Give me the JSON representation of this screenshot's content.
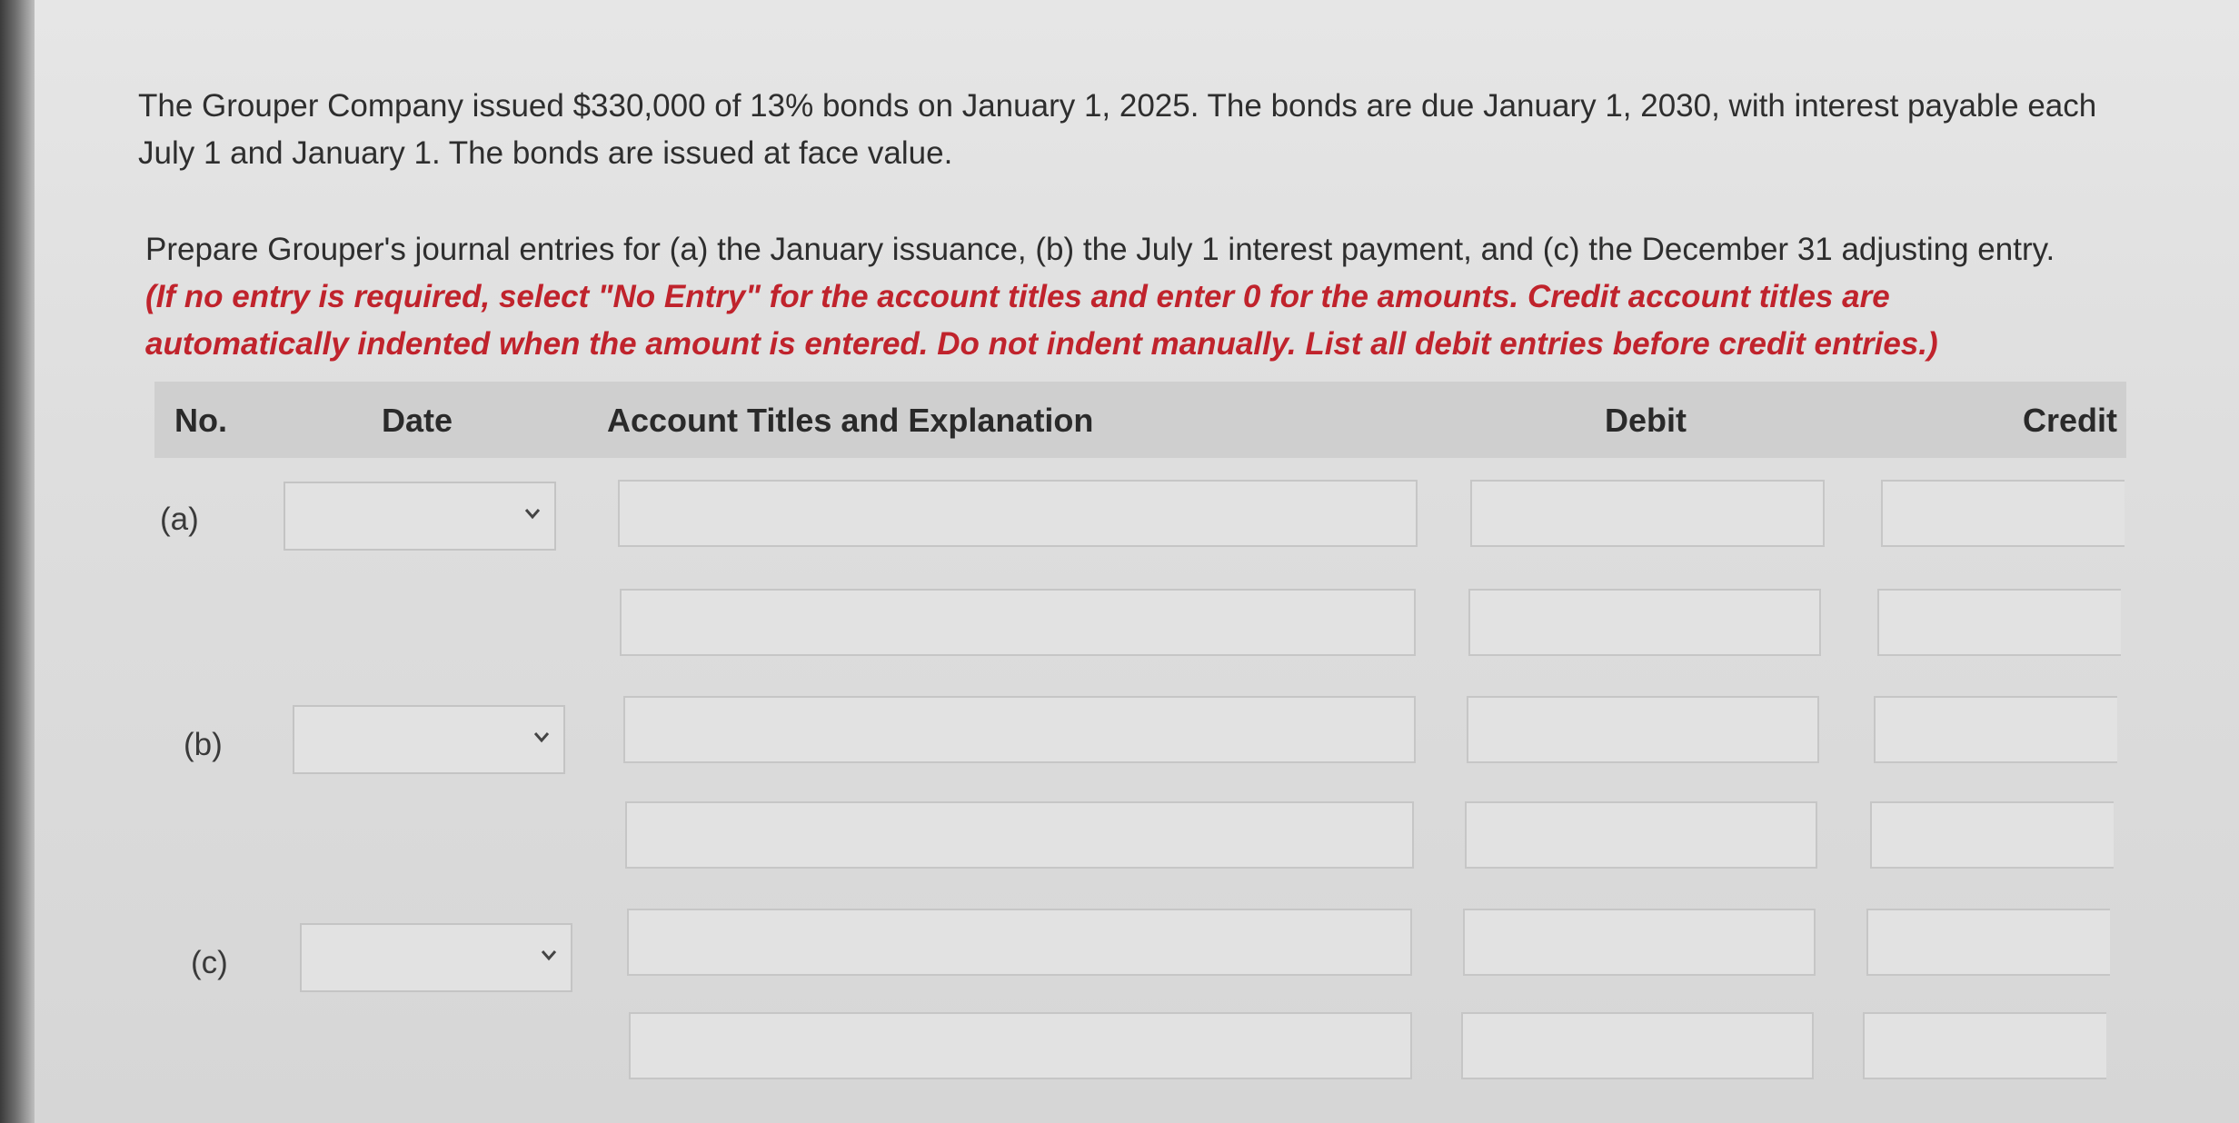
{
  "problem": {
    "statement": "The Grouper Company issued $330,000 of 13% bonds on January 1, 2025. The bonds are due January 1, 2030, with interest payable each July 1 and January 1. The bonds are issued at face value.",
    "prompt": "Prepare Grouper's journal entries for (a) the January issuance, (b) the July 1 interest payment, and (c) the December 31 adjusting entry.",
    "note": "(If no entry is required, select \"No Entry\" for the account titles and enter 0 for the amounts. Credit account titles are automatically indented when the amount is entered. Do not indent manually. List all debit entries before credit entries.)"
  },
  "table": {
    "headers": {
      "no": "No.",
      "date": "Date",
      "account": "Account Titles and Explanation",
      "debit": "Debit",
      "credit": "Credit"
    },
    "entries": [
      {
        "label": "(a)",
        "date_value": ""
      },
      {
        "label": "(b)",
        "date_value": ""
      },
      {
        "label": "(c)",
        "date_value": ""
      }
    ]
  },
  "icons": {
    "date_dropdown": "chevron-down-icon"
  }
}
